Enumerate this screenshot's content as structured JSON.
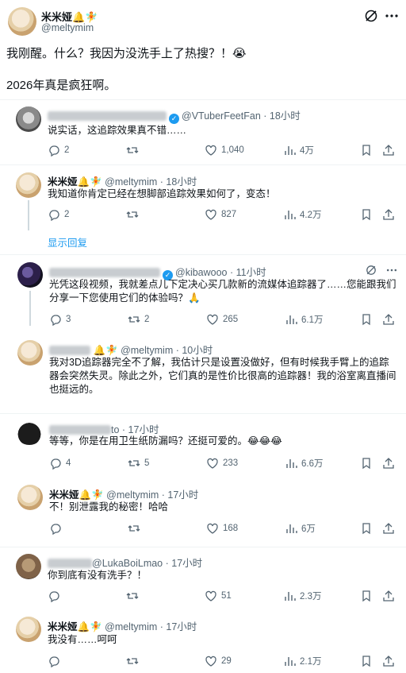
{
  "post": {
    "display_name": "米米娅🔔🧚",
    "handle": "@meltymim",
    "line1": "我刚醒。什么？我因为没洗手上了热搜？！😭",
    "line2": "2026年真是疯狂啊。"
  },
  "replies": [
    {
      "name": "",
      "handle": "@VTuberFeetFan",
      "verified": true,
      "time": "18小时",
      "text": "说实话，这追踪效果真不错……",
      "replies": "2",
      "retweets": "",
      "likes": "1,040",
      "views": "4万"
    },
    {
      "name": "米米娅🔔🧚",
      "handle": "@meltymim",
      "time": "18小时",
      "text": "我知道你肯定已经在想脚部追踪效果如何了，变态！",
      "replies": "2",
      "retweets": "",
      "likes": "827",
      "views": "4.2万"
    },
    {
      "name": "",
      "handle": "@kibawooo",
      "verified": true,
      "time": "11小时",
      "text": "光凭这段视频，我就差点儿下定决心买几款新的流媒体追踪器了……您能跟我们分享一下您使用它们的体验吗？🙏",
      "replies": "3",
      "retweets": "2",
      "likes": "265",
      "views": "6.1万"
    },
    {
      "name": "",
      "handle": "@meltymim",
      "time": "10小时",
      "text": "我对3D追踪器完全不了解，我估计只是设置没做好，但有时候我手臂上的追踪器会突然失灵。除此之外，它们真的是性价比很高的追踪器！我的浴室离直播间也挺远的。",
      "replies": "",
      "retweets": "",
      "likes": "",
      "views": ""
    },
    {
      "name": "",
      "handle": "",
      "time": "17小时",
      "text": "等等，你是在用卫生纸防漏吗？还挺可爱的。😂😂😂",
      "replies": "4",
      "retweets": "5",
      "likes": "233",
      "views": "6.6万"
    },
    {
      "name": "米米娅🔔🧚",
      "handle": "@meltymim",
      "time": "17小时",
      "text": "不！别泄露我的秘密！哈哈",
      "replies": "",
      "retweets": "",
      "likes": "168",
      "views": "6万"
    },
    {
      "name": "",
      "handle": "@LukaBoiLmao",
      "time": "17小时",
      "text": "你到底有没有洗手？！",
      "replies": "",
      "retweets": "",
      "likes": "51",
      "views": "2.3万"
    },
    {
      "name": "米米娅🔔🧚",
      "handle": "@meltymim",
      "time": "17小时",
      "text": "我没有……呵呵",
      "replies": "",
      "retweets": "",
      "likes": "29",
      "views": "2.1万"
    }
  ],
  "show_replies": "显示回复",
  "partial_handle_tail": "to",
  "icons": {
    "header": [
      "grok-icon",
      "more-icon"
    ],
    "actions": [
      "reply-icon",
      "retweet-icon",
      "like-icon",
      "views-icon",
      "bookmark-icon",
      "share-icon"
    ]
  },
  "colors": {
    "accent": "#1d9bf0",
    "muted": "#536471",
    "text": "#0f1419",
    "divider": "#eff3f4"
  }
}
